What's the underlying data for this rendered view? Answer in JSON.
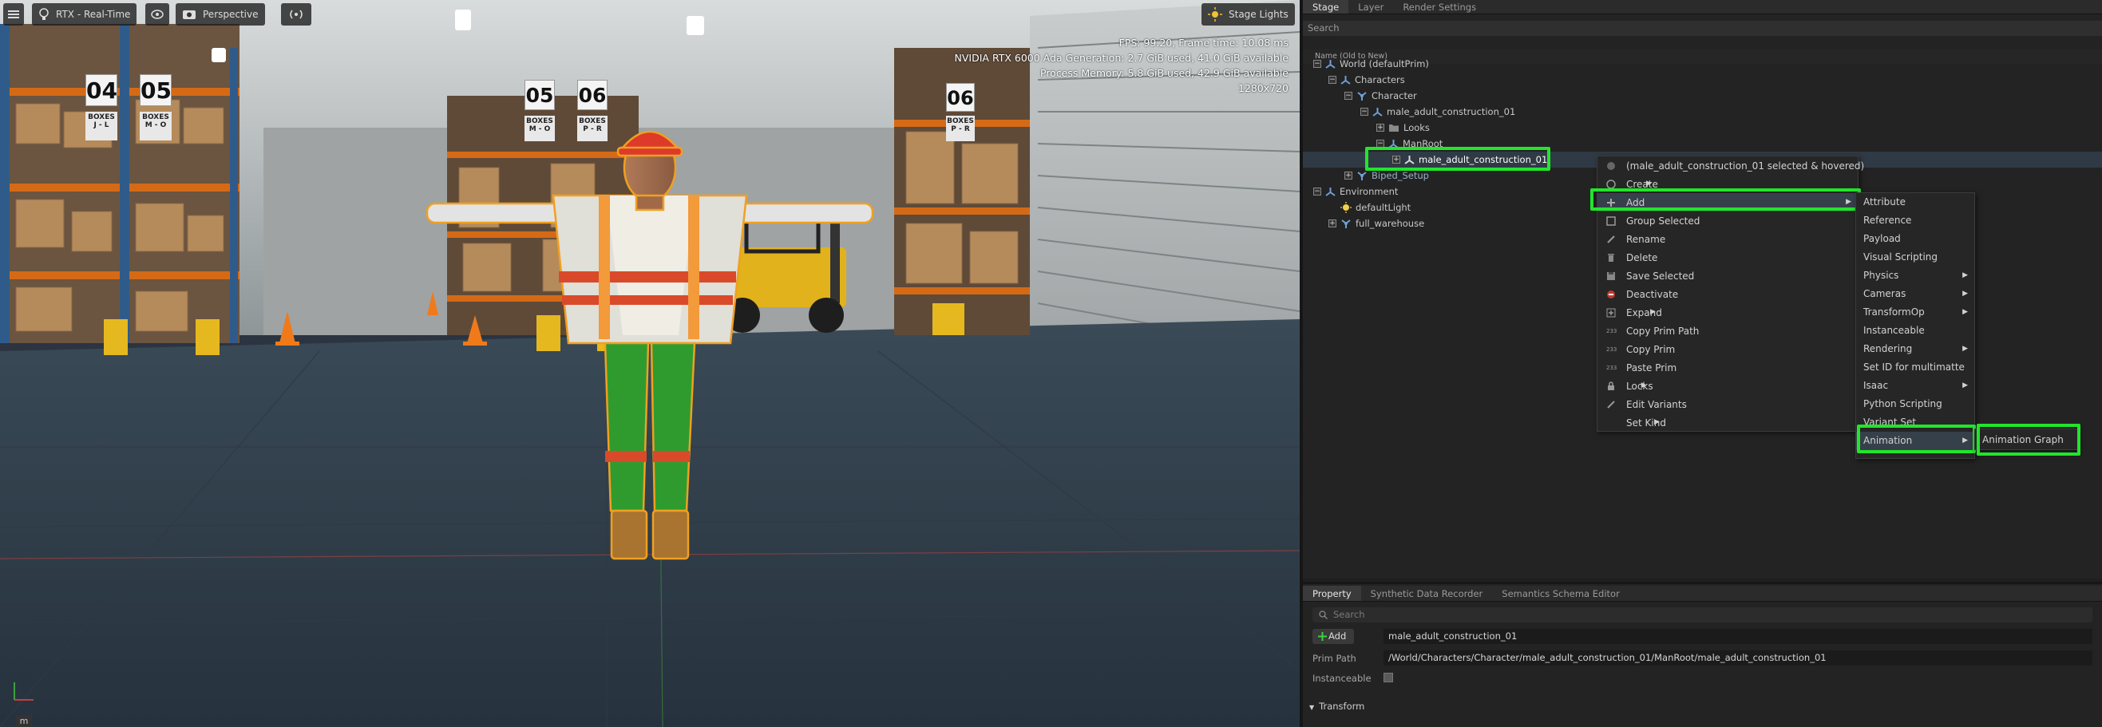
{
  "viewport": {
    "menu_icon": "hamburger-icon",
    "renderer_label": "RTX - Real-Time",
    "camera_label": "Perspective",
    "lights_label": "Stage Lights",
    "stats": [
      "FPS: 99.20, Frame time: 10.08 ms",
      "NVIDIA RTX 6000 Ada Generation: 2.7 GiB used, 41.0 GiB available",
      "Process Memory: 5.8 GiB used, 42.9 GiB available",
      "1280x720"
    ],
    "shelf_numbers": [
      "04",
      "05",
      "05",
      "06",
      "06"
    ],
    "shelf_plates": [
      "BOXES J - L",
      "BOXES M - O",
      "BOXES M - O",
      "BOXES P - R",
      "BOXES P - R"
    ],
    "corner_label": "m"
  },
  "stage": {
    "tabs": [
      "Stage",
      "Layer",
      "Render Settings"
    ],
    "search_placeholder": "Search",
    "column_header": "Name (Old to New)",
    "tree": [
      {
        "label": "World (defaultPrim)"
      },
      {
        "label": "Characters"
      },
      {
        "label": "Character"
      },
      {
        "label": "male_adult_construction_01"
      },
      {
        "label": "Looks"
      },
      {
        "label": "ManRoot"
      },
      {
        "label": "male_adult_construction_01"
      },
      {
        "label": "Biped_Setup"
      },
      {
        "label": "Environment"
      },
      {
        "label": "defaultLight"
      },
      {
        "label": "full_warehouse"
      }
    ]
  },
  "context_menu": {
    "items": [
      {
        "label": "(male_adult_construction_01 selected & hovered)"
      },
      {
        "label": "Create"
      },
      {
        "label": "Add"
      },
      {
        "label": "Group Selected"
      },
      {
        "label": "Rename"
      },
      {
        "label": "Delete"
      },
      {
        "label": "Save Selected"
      },
      {
        "label": "Deactivate"
      },
      {
        "label": "Expand"
      },
      {
        "label": "Copy Prim Path"
      },
      {
        "label": "Copy Prim"
      },
      {
        "label": "Paste Prim"
      },
      {
        "label": "Locks"
      },
      {
        "label": "Edit Variants"
      },
      {
        "label": "Set Kind"
      }
    ]
  },
  "add_submenu": {
    "items": [
      {
        "label": "Attribute"
      },
      {
        "label": "Reference"
      },
      {
        "label": "Payload"
      },
      {
        "label": "Visual Scripting"
      },
      {
        "label": "Physics"
      },
      {
        "label": "Cameras"
      },
      {
        "label": "TransformOp"
      },
      {
        "label": "Instanceable"
      },
      {
        "label": "Rendering"
      },
      {
        "label": "Set ID for multimatte"
      },
      {
        "label": "Isaac"
      },
      {
        "label": "Python Scripting"
      },
      {
        "label": "Variant Set"
      },
      {
        "label": "Animation"
      }
    ]
  },
  "animation_submenu": {
    "items": [
      {
        "label": "Animation Graph"
      }
    ]
  },
  "property": {
    "tabs": [
      "Property",
      "Synthetic Data Recorder",
      "Semantics Schema Editor"
    ],
    "search_placeholder": "Search",
    "add_label": "Add",
    "prim_name": "male_adult_construction_01",
    "prim_path_label": "Prim Path",
    "prim_path": "/World/Characters/Character/male_adult_construction_01/ManRoot/male_adult_construction_01",
    "instanceable_label": "Instanceable",
    "transform_label": "Transform"
  },
  "colors": {
    "highlight": "#22e52c",
    "panel_bg": "#232323",
    "vest": "#e8863a"
  }
}
